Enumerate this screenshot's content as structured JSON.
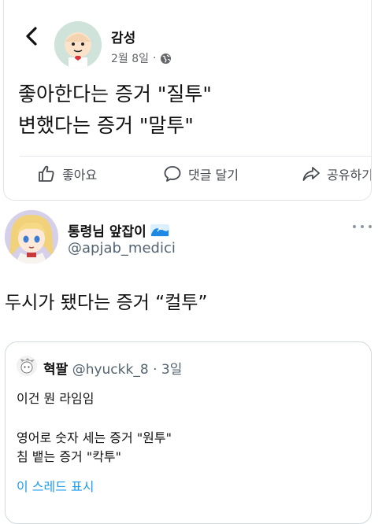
{
  "fb": {
    "author": "감성",
    "date": "2월 8일",
    "separator": "·",
    "post_lines": [
      "좋아한다는 증거 \"질투\"",
      "변했다는 증거 \"말투\""
    ],
    "actions": {
      "like": "좋아요",
      "comment": "댓글 달기",
      "share": "공유하기"
    }
  },
  "tweet": {
    "name": "통령님 앞잡이",
    "handle": "@apjab_medici",
    "text": "두시가 됐다는 증거 “컬투”",
    "quote": {
      "name": "혁팔",
      "handle": "@hyuckk_8",
      "separator": "·",
      "date": "3일",
      "line1": "이건 뭔 라임임",
      "line2": "영어로 숫자 세는 증거 \"원투\"",
      "line3": "침 뱉는 증거 \"칵투\"",
      "show_thread": "이 스레드 표시"
    }
  },
  "colors": {
    "link": "#1d9bf0",
    "muted": "#65676b",
    "handle": "#536471",
    "border": "#cfd9de"
  },
  "icons": [
    "back-icon",
    "globe-icon",
    "like-icon",
    "comment-icon",
    "share-icon",
    "wave-emoji-icon",
    "more-icon"
  ]
}
